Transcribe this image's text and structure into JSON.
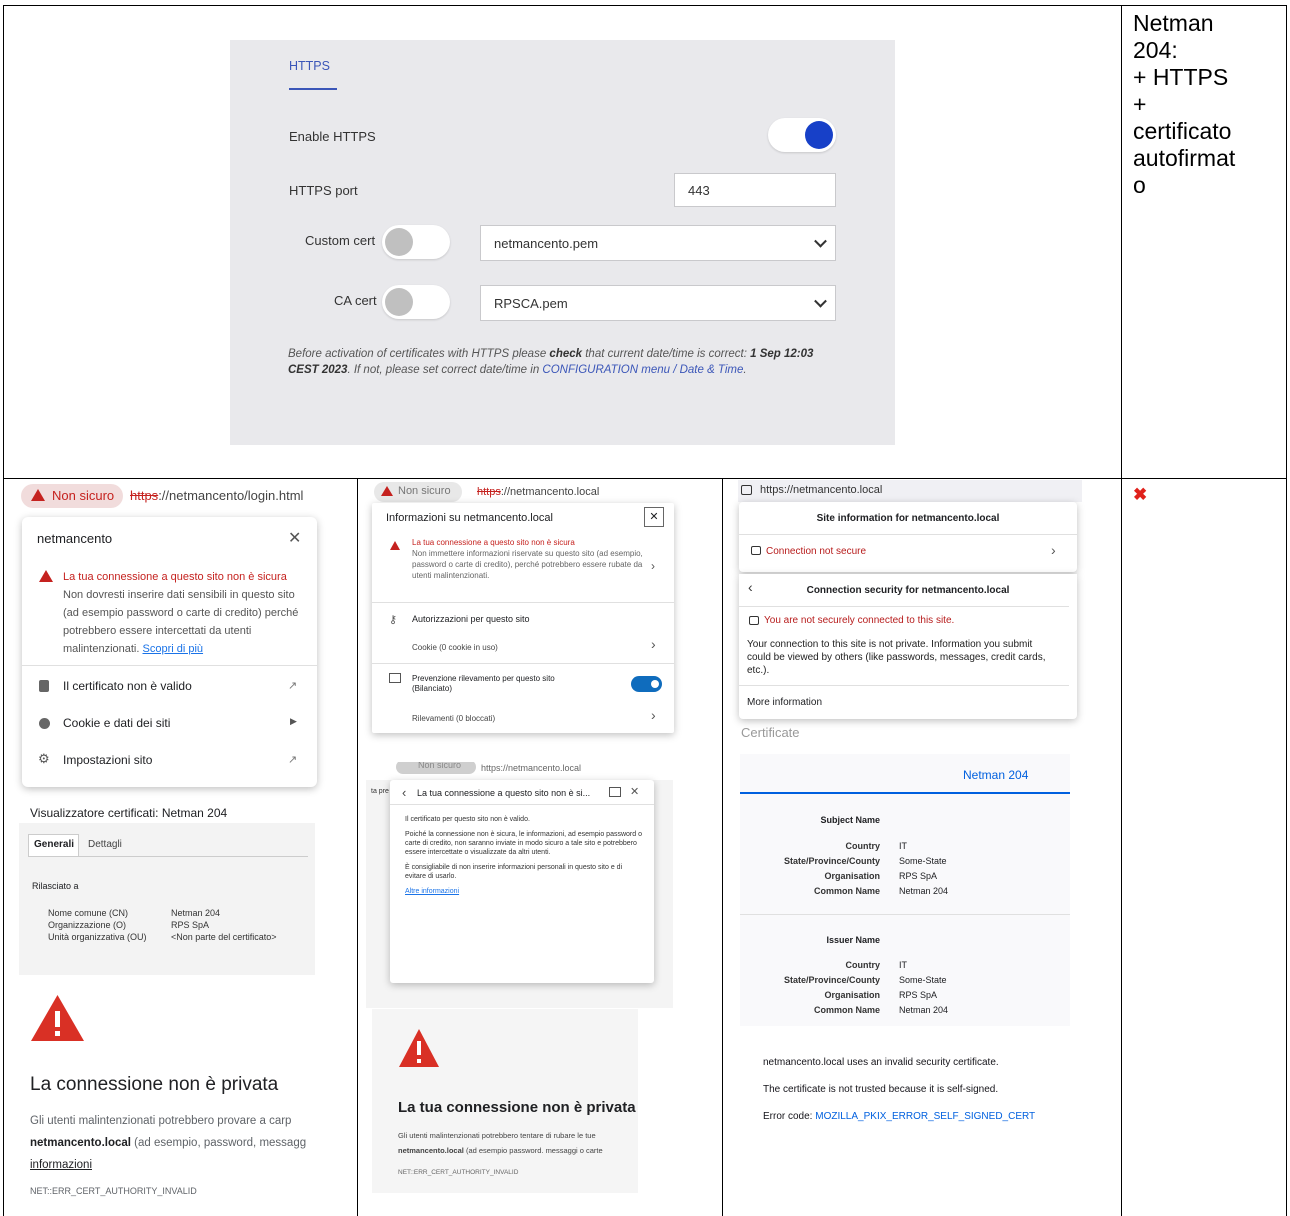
{
  "right_note": {
    "line1": "Netman",
    "line2": "204:",
    "line3": "+ HTTPS",
    "line4": "+",
    "line5": "certificato",
    "line6": "autofirmat",
    "line7": "o"
  },
  "result_mark": "✖",
  "https_panel": {
    "tab": "HTTPS",
    "enable_label": "Enable HTTPS",
    "port_label": "HTTPS port",
    "port_value": "443",
    "custom_cert_label": "Custom cert",
    "custom_cert_value": "netmancento.pem",
    "ca_cert_label": "CA cert",
    "ca_cert_value": "RPSCA.pem",
    "note_1": "Before activation of certificates with HTTPS please ",
    "note_check": "check",
    "note_2": " that current date/time is correct: ",
    "note_date": "1 Sep 12:03 CEST 2023",
    "note_3": ". If not, please set correct date/time in ",
    "note_link": "CONFIGURATION menu / Date & Time",
    "note_4": ".",
    "colors": {
      "panel_bg": "#e9e9ec",
      "toggle_on": "#1740c8",
      "tab_blue": "#3b56b8"
    }
  },
  "chrome": {
    "chip": "Non sicuro",
    "url_scheme": "https",
    "url_rest": "://netmancento/login.html",
    "popup_title": "netmancento",
    "warn_title": "La tua connessione a questo sito non è sicura",
    "warn_body": "Non dovresti inserire dati sensibili in questo sito (ad esempio password o carte di credito) perché potrebbero essere intercettati da utenti malintenzionati.",
    "learn_more": "Scopri di più",
    "item_cert": "Il certificato non è valido",
    "item_cookie": "Cookie e dati dei siti",
    "item_settings": "Impostazioni sito",
    "viewer_title": "Visualizzatore certificati: Netman 204",
    "tab_general": "Generali",
    "tab_details": "Dettagli",
    "issued_to": "Rilasciato a",
    "cn_label": "Nome comune (CN)",
    "cn_value": "Netman 204",
    "o_label": "Organizzazione (O)",
    "o_value": "RPS SpA",
    "ou_label": "Unità organizzativa (OU)",
    "ou_value": "<Non parte del certificato>",
    "error_title": "La connessione non è privata",
    "error_body_1": "Gli utenti malintenzionati potrebbero provare a carp",
    "error_host": "netmancento.local",
    "error_body_2": " (ad esempio, password, messagg",
    "error_link": "informazioni",
    "error_code": "NET::ERR_CERT_AUTHORITY_INVALID"
  },
  "edge": {
    "chip": "Non sicuro",
    "url_scheme": "https",
    "url_rest": "://netmancento.local",
    "popup_title": "Informazioni su netmancento.local",
    "warn_title": "La tua connessione a questo sito non è sicura",
    "warn_body": "Non immettere informazioni riservate su questo sito (ad esempio, password o carte di credito), perché potrebbero essere rubate da utenti malintenzionati.",
    "perm": "Autorizzazioni per questo sito",
    "cookie": "Cookie (0 cookie in uso)",
    "tracking": "Prevenzione rilevamento per questo sito (Bilanciato)",
    "detections": "Rilevamenti (0 bloccati)",
    "chip2": "Non sicuro",
    "url2": "https://netmancento.local",
    "cut_text": "ta pre",
    "popup2_title": "La tua connessione a questo sito non è si...",
    "p2_line1": "Il certificato per questo sito non è valido.",
    "p2_line2": "Poiché la connessione non è sicura, le informazioni, ad esempio password o carte di credito, non saranno inviate in modo sicuro a tale sito e potrebbero essere intercettate o visualizzate da altri utenti.",
    "p2_line3": "È consigliabile di non inserire informazioni personali in questo sito e di evitare di usarlo.",
    "p2_link": "Altre informazioni",
    "error_title": "La tua connessione non è privata",
    "error_body_1": "Gli utenti malintenzionati potrebbero tentare di rubare le tue",
    "error_host": "netmancento.local",
    "error_body_2": " (ad esempio password. messaggi o carte",
    "error_code": "NET::ERR_CERT_AUTHORITY_INVALID"
  },
  "firefox": {
    "url": "https://netmancento.local",
    "site_info_title": "Site information for netmancento.local",
    "conn_not_secure": "Connection not secure",
    "conn_sec_title": "Connection security for netmancento.local",
    "not_securely": "You are not securely connected to this site.",
    "not_private": "Your connection to this site is not private. Information you submit could be viewed by others (like passwords, messages, credit cards, etc.).",
    "more_info": "More information",
    "certificate_label": "Certificate",
    "cert_tab": "Netman 204",
    "subject_name": "Subject Name",
    "issuer_name": "Issuer Name",
    "country_label": "Country",
    "country_value": "IT",
    "state_label": "State/Province/County",
    "state_value": "Some-State",
    "org_label": "Organisation",
    "org_value": "RPS SpA",
    "cn_label": "Common Name",
    "cn_value": "Netman 204",
    "err_line1": "netmancento.local uses an invalid security certificate.",
    "err_line2": "The certificate is not trusted because it is self-signed.",
    "err_code_label": "Error code: ",
    "err_code": "MOZILLA_PKIX_ERROR_SELF_SIGNED_CERT"
  }
}
